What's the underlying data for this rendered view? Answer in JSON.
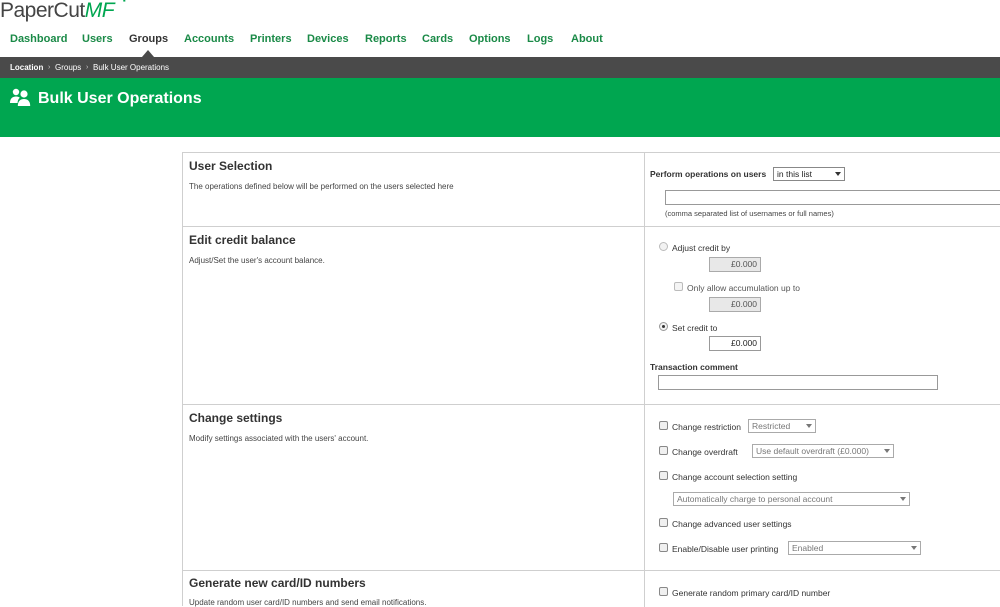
{
  "app": {
    "logo_text": "PaperCut",
    "logo_suffix": "MF"
  },
  "nav": {
    "items": [
      {
        "label": "Dashboard"
      },
      {
        "label": "Users"
      },
      {
        "label": "Groups",
        "active": true
      },
      {
        "label": "Accounts"
      },
      {
        "label": "Printers"
      },
      {
        "label": "Devices"
      },
      {
        "label": "Reports"
      },
      {
        "label": "Cards"
      },
      {
        "label": "Options"
      },
      {
        "label": "Logs"
      },
      {
        "label": "About"
      }
    ]
  },
  "breadcrumb": {
    "items": [
      "Location",
      "Groups",
      "Bulk User Operations"
    ],
    "separator": "›"
  },
  "page": {
    "title": "Bulk User Operations",
    "icon": "users-group-icon"
  },
  "sections": {
    "user_selection": {
      "title": "User Selection",
      "description": "The operations defined below will be performed on the users selected here",
      "perform_label": "Perform operations on users",
      "scope_selected": "in this list",
      "user_list_value": "",
      "user_list_hint": "(comma separated list of usernames or full names)"
    },
    "credit": {
      "title": "Edit credit balance",
      "description": "Adjust/Set the user's account balance.",
      "adjust_label": "Adjust credit by",
      "adjust_value": "£0.000",
      "accumulate_label": "Only allow accumulation up to",
      "accumulate_value": "£0.000",
      "set_label": "Set credit to",
      "set_value": "£0.000",
      "comment_label": "Transaction comment",
      "comment_value": ""
    },
    "settings": {
      "title": "Change settings",
      "description": "Modify settings associated with the users' account.",
      "restriction_label": "Change restriction",
      "restriction_value": "Restricted",
      "overdraft_label": "Change overdraft",
      "overdraft_value": "Use default overdraft (£0.000)",
      "account_selection_label": "Change account selection setting",
      "account_selection_value": "Automatically charge to personal account",
      "advanced_label": "Change advanced user settings",
      "printing_label": "Enable/Disable user printing",
      "printing_value": "Enabled"
    },
    "card": {
      "title": "Generate new card/ID numbers",
      "description": "Update random user card/ID numbers and send email notifications.",
      "random_primary_label": "Generate random primary card/ID number"
    }
  },
  "colors": {
    "brand_green": "#00a650",
    "nav_green": "#1a8a47",
    "breadcrumb_bg": "#4a4a4a"
  }
}
